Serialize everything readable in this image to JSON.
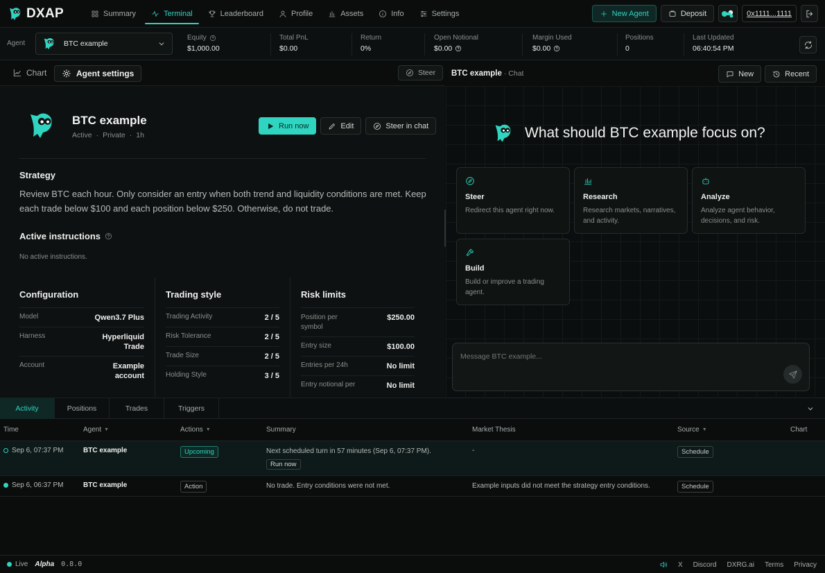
{
  "brand": {
    "name": "DXAP"
  },
  "nav": [
    {
      "label": "Summary",
      "icon": "grid-icon"
    },
    {
      "label": "Terminal",
      "icon": "pulse-icon",
      "active": true
    },
    {
      "label": "Leaderboard",
      "icon": "trophy-icon"
    },
    {
      "label": "Profile",
      "icon": "user-icon"
    },
    {
      "label": "Assets",
      "icon": "bar-chart-icon"
    },
    {
      "label": "Info",
      "icon": "info-icon"
    },
    {
      "label": "Settings",
      "icon": "sliders-icon"
    }
  ],
  "topbar": {
    "new_agent": "New Agent",
    "deposit": "Deposit",
    "wallet": "0x1111...1111"
  },
  "stats": {
    "agent_label": "Agent",
    "agent_selected": "BTC example",
    "items": [
      {
        "label": "Equity",
        "value": "$1,000.00"
      },
      {
        "label": "Total PnL",
        "value": "$0.00"
      },
      {
        "label": "Return",
        "value": "0%"
      },
      {
        "label": "Open Notional",
        "value": "$0.00"
      },
      {
        "label": "Margin Used",
        "value": "$0.00"
      },
      {
        "label": "Positions",
        "value": "0"
      },
      {
        "label": "Last Updated",
        "value": "06:40:54 PM"
      }
    ]
  },
  "left": {
    "tab_chart": "Chart",
    "tab_settings": "Agent settings",
    "steer": "Steer",
    "agent": {
      "name": "BTC example",
      "status": "Active",
      "visibility": "Private",
      "age": "1h"
    },
    "buttons": {
      "run_now": "Run now",
      "edit": "Edit",
      "steer_chat": "Steer in chat"
    },
    "strategy_title": "Strategy",
    "strategy_text": "Review BTC each hour. Only consider an entry when both trend and liquidity conditions are met. Keep each trade below $100 and each position below $250. Otherwise, do not trade.",
    "instructions_title": "Active instructions",
    "instructions_empty": "No active instructions.",
    "configuration": {
      "title": "Configuration",
      "rows": [
        {
          "k": "Model",
          "v": "Qwen3.7 Plus"
        },
        {
          "k": "Harness",
          "v": "Hyperliquid Trade"
        },
        {
          "k": "Account",
          "v": "Example account"
        }
      ]
    },
    "trading_style": {
      "title": "Trading style",
      "rows": [
        {
          "k": "Trading Activity",
          "v": "2 / 5"
        },
        {
          "k": "Risk Tolerance",
          "v": "2 / 5"
        },
        {
          "k": "Trade Size",
          "v": "2 / 5"
        },
        {
          "k": "Holding Style",
          "v": "3 / 5"
        }
      ]
    },
    "risk_limits": {
      "title": "Risk limits",
      "rows": [
        {
          "k": "Position per symbol",
          "v": "$250.00"
        },
        {
          "k": "Entry size",
          "v": "$100.00"
        },
        {
          "k": "Entries per 24h",
          "v": "No limit"
        },
        {
          "k": "Entry notional per",
          "v": "No limit"
        }
      ]
    }
  },
  "chat": {
    "title": "BTC example",
    "subtitle": "· Chat",
    "new": "New",
    "recent": "Recent",
    "hero": "What should BTC example focus on?",
    "cards": [
      {
        "title": "Steer",
        "desc": "Redirect this agent right now.",
        "icon": "compass-icon"
      },
      {
        "title": "Research",
        "desc": "Research markets, narratives, and activity.",
        "icon": "bars-icon"
      },
      {
        "title": "Analyze",
        "desc": "Analyze agent behavior, decisions, and risk.",
        "icon": "bot-icon"
      },
      {
        "title": "Build",
        "desc": "Build or improve a trading agent.",
        "icon": "hammer-icon"
      }
    ],
    "placeholder": "Message BTC example..."
  },
  "activity": {
    "tabs": [
      "Activity",
      "Positions",
      "Trades",
      "Triggers"
    ],
    "columns": [
      "Time",
      "Agent",
      "Actions",
      "Summary",
      "Market Thesis",
      "Source",
      "Chart"
    ],
    "rows": [
      {
        "time": "Sep 6, 07:37 PM",
        "agent": "BTC example",
        "action": "Upcoming",
        "summary": "Next scheduled turn in 57 minutes (Sep 6, 07:37 PM).",
        "run_now": "Run now",
        "thesis": "-",
        "source": "Schedule"
      },
      {
        "time": "Sep 6, 06:37 PM",
        "agent": "BTC example",
        "action": "Action",
        "summary": "No trade. Entry conditions were not met.",
        "thesis": "Example inputs did not meet the strategy entry conditions.",
        "source": "Schedule"
      }
    ]
  },
  "footer": {
    "live": "Live",
    "alpha": "Alpha",
    "version": "0.8.0",
    "links": [
      "X",
      "Discord",
      "DXRG.ai",
      "Terms",
      "Privacy"
    ]
  }
}
